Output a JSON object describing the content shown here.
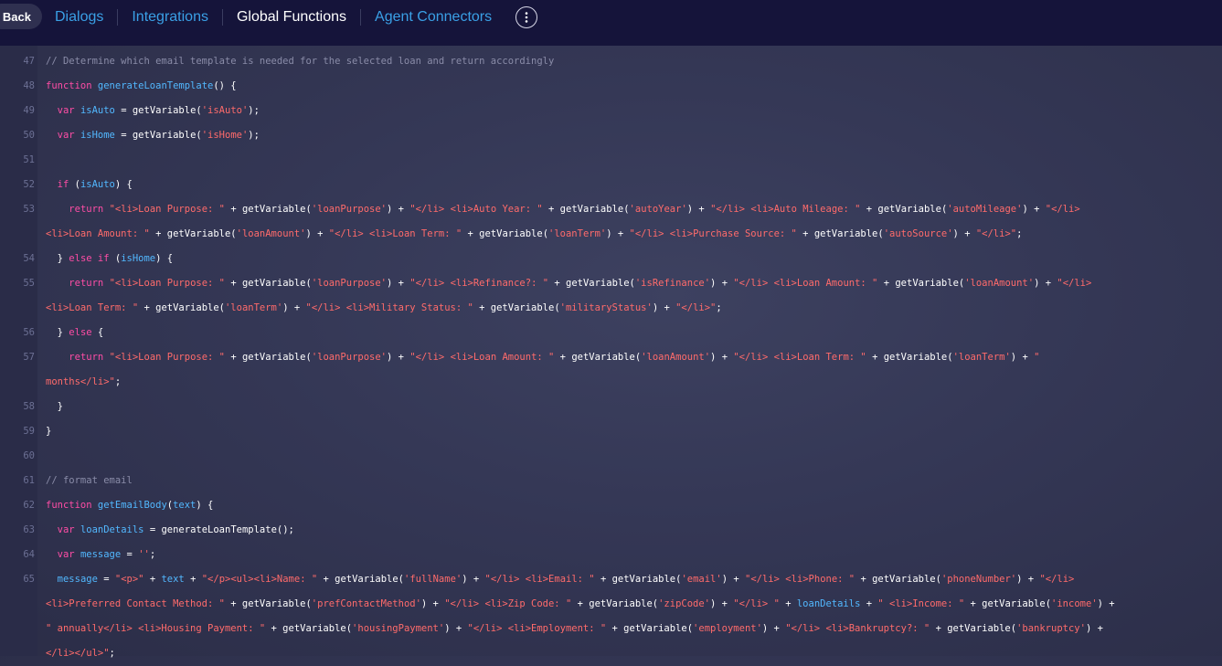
{
  "topbar": {
    "back_label": "Back",
    "tabs": [
      {
        "label": "Dialogs",
        "active": false
      },
      {
        "label": "Integrations",
        "active": false
      },
      {
        "label": "Global Functions",
        "active": true
      },
      {
        "label": "Agent Connectors",
        "active": false
      }
    ],
    "more_icon": "vertical-ellipsis-icon"
  },
  "colors": {
    "topbar_bg": "#15143a",
    "tab_link": "#3aa0e6",
    "tab_active": "#ffffff",
    "keyword": "#ff4da6",
    "identifier": "#52b8ff",
    "string": "#ff6b6b",
    "comment": "#8a8ca8"
  },
  "editor": {
    "lines": [
      {
        "num": "47",
        "tokens": [
          {
            "t": "c",
            "v": "// Determine which email template is needed for the selected loan and return accordingly"
          }
        ]
      },
      {
        "num": "48",
        "tokens": [
          {
            "t": "k",
            "v": "function "
          },
          {
            "t": "f",
            "v": "generateLoanTemplate"
          },
          {
            "t": "w",
            "v": "() {"
          }
        ]
      },
      {
        "num": "49",
        "tokens": [
          {
            "t": "w",
            "v": "  "
          },
          {
            "t": "k",
            "v": "var "
          },
          {
            "t": "f",
            "v": "isAuto"
          },
          {
            "t": "w",
            "v": " = getVariable("
          },
          {
            "t": "s",
            "v": "'isAuto'"
          },
          {
            "t": "w",
            "v": ");"
          }
        ]
      },
      {
        "num": "50",
        "tokens": [
          {
            "t": "w",
            "v": "  "
          },
          {
            "t": "k",
            "v": "var "
          },
          {
            "t": "f",
            "v": "isHome"
          },
          {
            "t": "w",
            "v": " = getVariable("
          },
          {
            "t": "s",
            "v": "'isHome'"
          },
          {
            "t": "w",
            "v": ");"
          }
        ]
      },
      {
        "num": "51",
        "tokens": []
      },
      {
        "num": "52",
        "tokens": [
          {
            "t": "w",
            "v": "  "
          },
          {
            "t": "k",
            "v": "if "
          },
          {
            "t": "w",
            "v": "("
          },
          {
            "t": "f",
            "v": "isAuto"
          },
          {
            "t": "w",
            "v": ") {"
          }
        ]
      },
      {
        "num": "53",
        "tokens": [
          {
            "t": "w",
            "v": "    "
          },
          {
            "t": "k",
            "v": "return "
          },
          {
            "t": "s",
            "v": "\"<li>Loan Purpose: \""
          },
          {
            "t": "w",
            "v": " + getVariable("
          },
          {
            "t": "s",
            "v": "'loanPurpose'"
          },
          {
            "t": "w",
            "v": ") + "
          },
          {
            "t": "s",
            "v": "\"</li> <li>Auto Year: \""
          },
          {
            "t": "w",
            "v": " + getVariable("
          },
          {
            "t": "s",
            "v": "'autoYear'"
          },
          {
            "t": "w",
            "v": ") + "
          },
          {
            "t": "s",
            "v": "\"</li> <li>Auto Mileage: \""
          },
          {
            "t": "w",
            "v": " + getVariable("
          },
          {
            "t": "s",
            "v": "'autoMileage'"
          },
          {
            "t": "w",
            "v": ") + "
          },
          {
            "t": "s",
            "v": "\"</li>"
          }
        ]
      },
      {
        "num": "",
        "tokens": [
          {
            "t": "s",
            "v": "<li>Loan Amount: \""
          },
          {
            "t": "w",
            "v": " + getVariable("
          },
          {
            "t": "s",
            "v": "'loanAmount'"
          },
          {
            "t": "w",
            "v": ") + "
          },
          {
            "t": "s",
            "v": "\"</li> <li>Loan Term: \""
          },
          {
            "t": "w",
            "v": " + getVariable("
          },
          {
            "t": "s",
            "v": "'loanTerm'"
          },
          {
            "t": "w",
            "v": ") + "
          },
          {
            "t": "s",
            "v": "\"</li> <li>Purchase Source: \""
          },
          {
            "t": "w",
            "v": " + getVariable("
          },
          {
            "t": "s",
            "v": "'autoSource'"
          },
          {
            "t": "w",
            "v": ") + "
          },
          {
            "t": "s",
            "v": "\"</li>\""
          },
          {
            "t": "w",
            "v": ";"
          }
        ]
      },
      {
        "num": "54",
        "tokens": [
          {
            "t": "w",
            "v": "  } "
          },
          {
            "t": "k",
            "v": "else if "
          },
          {
            "t": "w",
            "v": "("
          },
          {
            "t": "f",
            "v": "isHome"
          },
          {
            "t": "w",
            "v": ") {"
          }
        ]
      },
      {
        "num": "55",
        "tokens": [
          {
            "t": "w",
            "v": "    "
          },
          {
            "t": "k",
            "v": "return "
          },
          {
            "t": "s",
            "v": "\"<li>Loan Purpose: \""
          },
          {
            "t": "w",
            "v": " + getVariable("
          },
          {
            "t": "s",
            "v": "'loanPurpose'"
          },
          {
            "t": "w",
            "v": ") + "
          },
          {
            "t": "s",
            "v": "\"</li> <li>Refinance?: \""
          },
          {
            "t": "w",
            "v": " + getVariable("
          },
          {
            "t": "s",
            "v": "'isRefinance'"
          },
          {
            "t": "w",
            "v": ") + "
          },
          {
            "t": "s",
            "v": "\"</li> <li>Loan Amount: \""
          },
          {
            "t": "w",
            "v": " + getVariable("
          },
          {
            "t": "s",
            "v": "'loanAmount'"
          },
          {
            "t": "w",
            "v": ") + "
          },
          {
            "t": "s",
            "v": "\"</li>"
          }
        ]
      },
      {
        "num": "",
        "tokens": [
          {
            "t": "s",
            "v": "<li>Loan Term: \""
          },
          {
            "t": "w",
            "v": " + getVariable("
          },
          {
            "t": "s",
            "v": "'loanTerm'"
          },
          {
            "t": "w",
            "v": ") + "
          },
          {
            "t": "s",
            "v": "\"</li> <li>Military Status: \""
          },
          {
            "t": "w",
            "v": " + getVariable("
          },
          {
            "t": "s",
            "v": "'militaryStatus'"
          },
          {
            "t": "w",
            "v": ") + "
          },
          {
            "t": "s",
            "v": "\"</li>\""
          },
          {
            "t": "w",
            "v": ";"
          }
        ]
      },
      {
        "num": "56",
        "tokens": [
          {
            "t": "w",
            "v": "  } "
          },
          {
            "t": "k",
            "v": "else "
          },
          {
            "t": "w",
            "v": "{"
          }
        ]
      },
      {
        "num": "57",
        "tokens": [
          {
            "t": "w",
            "v": "    "
          },
          {
            "t": "k",
            "v": "return "
          },
          {
            "t": "s",
            "v": "\"<li>Loan Purpose: \""
          },
          {
            "t": "w",
            "v": " + getVariable("
          },
          {
            "t": "s",
            "v": "'loanPurpose'"
          },
          {
            "t": "w",
            "v": ") + "
          },
          {
            "t": "s",
            "v": "\"</li> <li>Loan Amount: \""
          },
          {
            "t": "w",
            "v": " + getVariable("
          },
          {
            "t": "s",
            "v": "'loanAmount'"
          },
          {
            "t": "w",
            "v": ") + "
          },
          {
            "t": "s",
            "v": "\"</li> <li>Loan Term: \""
          },
          {
            "t": "w",
            "v": " + getVariable("
          },
          {
            "t": "s",
            "v": "'loanTerm'"
          },
          {
            "t": "w",
            "v": ") + "
          },
          {
            "t": "s",
            "v": "\""
          }
        ]
      },
      {
        "num": "",
        "tokens": [
          {
            "t": "s",
            "v": "months</li>\""
          },
          {
            "t": "w",
            "v": ";"
          }
        ]
      },
      {
        "num": "58",
        "tokens": [
          {
            "t": "w",
            "v": "  }"
          }
        ]
      },
      {
        "num": "59",
        "tokens": [
          {
            "t": "w",
            "v": "}"
          }
        ]
      },
      {
        "num": "60",
        "tokens": []
      },
      {
        "num": "61",
        "tokens": [
          {
            "t": "c",
            "v": "// format email"
          }
        ]
      },
      {
        "num": "62",
        "tokens": [
          {
            "t": "k",
            "v": "function "
          },
          {
            "t": "f",
            "v": "getEmailBody"
          },
          {
            "t": "w",
            "v": "("
          },
          {
            "t": "f",
            "v": "text"
          },
          {
            "t": "w",
            "v": ") {"
          }
        ]
      },
      {
        "num": "63",
        "tokens": [
          {
            "t": "w",
            "v": "  "
          },
          {
            "t": "k",
            "v": "var "
          },
          {
            "t": "f",
            "v": "loanDetails"
          },
          {
            "t": "w",
            "v": " = generateLoanTemplate();"
          }
        ]
      },
      {
        "num": "64",
        "tokens": [
          {
            "t": "w",
            "v": "  "
          },
          {
            "t": "k",
            "v": "var "
          },
          {
            "t": "f",
            "v": "message"
          },
          {
            "t": "w",
            "v": " = "
          },
          {
            "t": "s",
            "v": "''"
          },
          {
            "t": "w",
            "v": ";"
          }
        ]
      },
      {
        "num": "65",
        "tokens": [
          {
            "t": "w",
            "v": "  "
          },
          {
            "t": "f",
            "v": "message"
          },
          {
            "t": "w",
            "v": " = "
          },
          {
            "t": "s",
            "v": "\"<p>\""
          },
          {
            "t": "w",
            "v": " + "
          },
          {
            "t": "f",
            "v": "text"
          },
          {
            "t": "w",
            "v": " + "
          },
          {
            "t": "s",
            "v": "\"</p><ul><li>Name: \""
          },
          {
            "t": "w",
            "v": " + getVariable("
          },
          {
            "t": "s",
            "v": "'fullName'"
          },
          {
            "t": "w",
            "v": ") + "
          },
          {
            "t": "s",
            "v": "\"</li> <li>Email: \""
          },
          {
            "t": "w",
            "v": " + getVariable("
          },
          {
            "t": "s",
            "v": "'email'"
          },
          {
            "t": "w",
            "v": ") + "
          },
          {
            "t": "s",
            "v": "\"</li> <li>Phone: \""
          },
          {
            "t": "w",
            "v": " + getVariable("
          },
          {
            "t": "s",
            "v": "'phoneNumber'"
          },
          {
            "t": "w",
            "v": ") + "
          },
          {
            "t": "s",
            "v": "\"</li>"
          }
        ]
      },
      {
        "num": "",
        "tokens": [
          {
            "t": "s",
            "v": "<li>Preferred Contact Method: \""
          },
          {
            "t": "w",
            "v": " + getVariable("
          },
          {
            "t": "s",
            "v": "'prefContactMethod'"
          },
          {
            "t": "w",
            "v": ") + "
          },
          {
            "t": "s",
            "v": "\"</li> <li>Zip Code: \""
          },
          {
            "t": "w",
            "v": " + getVariable("
          },
          {
            "t": "s",
            "v": "'zipCode'"
          },
          {
            "t": "w",
            "v": ") + "
          },
          {
            "t": "s",
            "v": "\"</li> \""
          },
          {
            "t": "w",
            "v": " + "
          },
          {
            "t": "f",
            "v": "loanDetails"
          },
          {
            "t": "w",
            "v": " + "
          },
          {
            "t": "s",
            "v": "\" <li>Income: \""
          },
          {
            "t": "w",
            "v": " + getVariable("
          },
          {
            "t": "s",
            "v": "'income'"
          },
          {
            "t": "w",
            "v": ") +"
          }
        ]
      },
      {
        "num": "",
        "tokens": [
          {
            "t": "s",
            "v": "\" annually</li> <li>Housing Payment: \""
          },
          {
            "t": "w",
            "v": " + getVariable("
          },
          {
            "t": "s",
            "v": "'housingPayment'"
          },
          {
            "t": "w",
            "v": ") + "
          },
          {
            "t": "s",
            "v": "\"</li> <li>Employment: \""
          },
          {
            "t": "w",
            "v": " + getVariable("
          },
          {
            "t": "s",
            "v": "'employment'"
          },
          {
            "t": "w",
            "v": ") + "
          },
          {
            "t": "s",
            "v": "\"</li> <li>Bankruptcy?: \""
          },
          {
            "t": "w",
            "v": " + getVariable("
          },
          {
            "t": "s",
            "v": "'bankruptcy'"
          },
          {
            "t": "w",
            "v": ") +"
          }
        ]
      },
      {
        "num": "",
        "tokens": [
          {
            "t": "s",
            "v": "</li></ul>\""
          },
          {
            "t": "w",
            "v": ";"
          }
        ]
      }
    ]
  }
}
